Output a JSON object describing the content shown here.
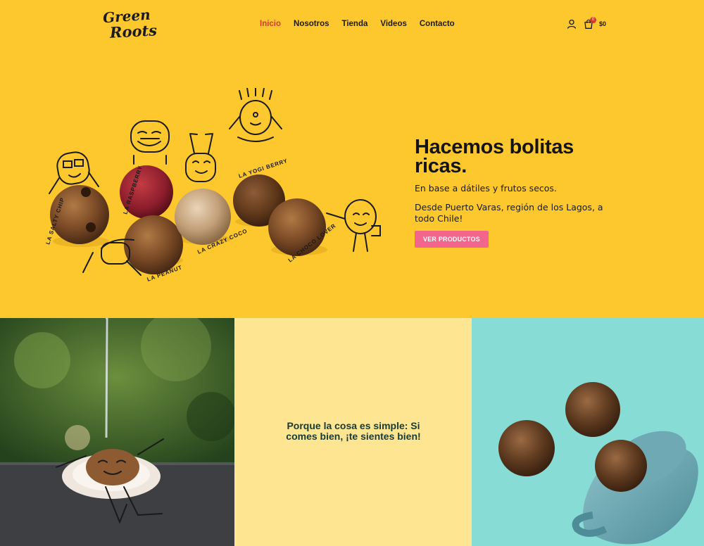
{
  "brand": {
    "logo_line1": "Green",
    "logo_line2": "Roots"
  },
  "nav": {
    "items": [
      {
        "label": "Inicio",
        "active": true
      },
      {
        "label": "Nosotros"
      },
      {
        "label": "Tienda"
      },
      {
        "label": "Videos"
      },
      {
        "label": "Contacto"
      }
    ]
  },
  "header_tools": {
    "user_icon": "user-icon",
    "cart_icon": "shopping-bag-icon",
    "cart_count": "0",
    "cart_total": "$0"
  },
  "hero": {
    "title": "Hacemos bolitas ricas.",
    "subtitle": "En base a dátiles y frutos secos.",
    "description": "Desde Puerto Varas, región de los Lagos, a todo Chile!",
    "cta_label": "VER PRODUCTOS",
    "ball_labels": [
      "LA SALTY CHIP",
      "LA RASPBERRY",
      "LA YOGI BERRY",
      "LA CRAZY COCO",
      "LA PEANUT",
      "LA CHOCO LOVER"
    ]
  },
  "panels": {
    "quote": "Porque la cosa es simple: Si comes bien, ¡te sientes bien!"
  },
  "colors": {
    "background": "#fdc82d",
    "accent_red": "#d23b2a",
    "cta_pink": "#f2668b",
    "panel_cream": "#fde591",
    "panel_teal": "#87ddd6",
    "quote_text": "#173a37"
  }
}
